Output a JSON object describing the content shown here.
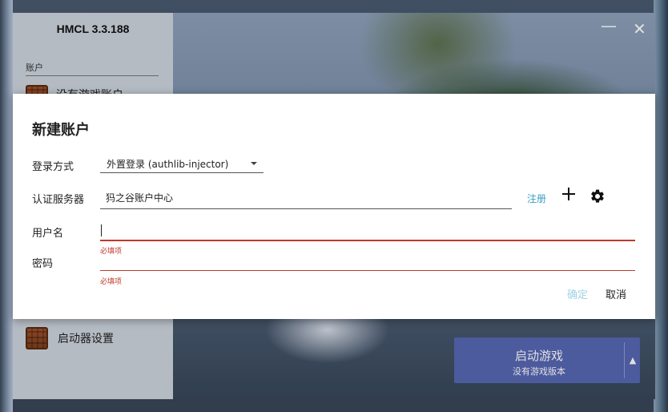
{
  "window": {
    "app_title": "HMCL 3.3.188",
    "minimize_glyph": "—",
    "close_glyph": "✕"
  },
  "sidebar": {
    "section_label": "账户",
    "account_item": "没有游戏账户",
    "settings_item": "启动器设置"
  },
  "launch_button": {
    "label": "启动游戏",
    "sublabel": "没有游戏版本",
    "arrow": "▲"
  },
  "dialog": {
    "title": "新建账户",
    "login_method": {
      "label": "登录方式",
      "value": "外置登录 (authlib-injector)"
    },
    "auth_server": {
      "label": "认证服务器",
      "value": "犸之谷账户中心",
      "register_link": "注册"
    },
    "username": {
      "label": "用户名",
      "value": "",
      "error": "必填项"
    },
    "password": {
      "label": "密码",
      "value": "",
      "error": "必填项"
    },
    "confirm_label": "确定",
    "cancel_label": "取消"
  },
  "colors": {
    "accent": "#5767b4",
    "error": "#c0392b",
    "link": "#3b9ec4",
    "disabled_confirm": "#9fd3e6"
  }
}
